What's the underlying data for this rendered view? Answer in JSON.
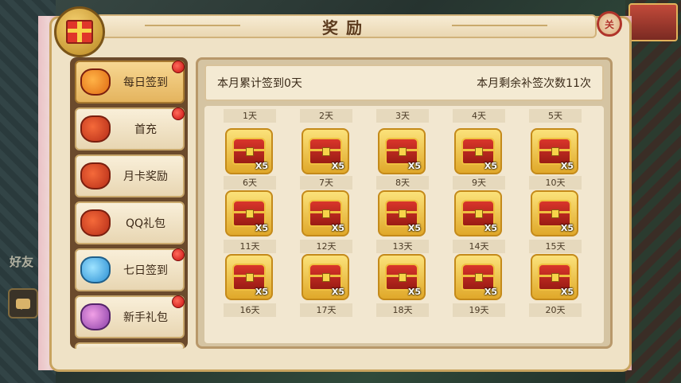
{
  "title": "奖励",
  "close_label": "关",
  "side_label_extra": "好友",
  "sidebar": {
    "items": [
      {
        "label": "每日签到",
        "icon": "coin-bag-icon",
        "active": true,
        "badge": true
      },
      {
        "label": "首充",
        "icon": "gift-bag-icon",
        "active": false,
        "badge": true
      },
      {
        "label": "月卡奖励",
        "icon": "gift-bag-icon",
        "active": false,
        "badge": false
      },
      {
        "label": "QQ礼包",
        "icon": "gift-bag-icon",
        "active": false,
        "badge": false
      },
      {
        "label": "七日签到",
        "icon": "crystal-bag-icon",
        "active": false,
        "badge": true
      },
      {
        "label": "新手礼包",
        "icon": "purple-bag-icon",
        "active": false,
        "badge": true
      }
    ]
  },
  "info": {
    "signed_text": "本月累计签到0天",
    "remaining_text": "本月剩余补签次数11次"
  },
  "days": [
    {
      "label": "1天",
      "qty": "X5"
    },
    {
      "label": "2天",
      "qty": "X5"
    },
    {
      "label": "3天",
      "qty": "X5"
    },
    {
      "label": "4天",
      "qty": "X5"
    },
    {
      "label": "5天",
      "qty": "X5"
    },
    {
      "label": "6天",
      "qty": "X5"
    },
    {
      "label": "7天",
      "qty": "X5"
    },
    {
      "label": "8天",
      "qty": "X5"
    },
    {
      "label": "9天",
      "qty": "X5"
    },
    {
      "label": "10天",
      "qty": "X5"
    },
    {
      "label": "11天",
      "qty": "X5"
    },
    {
      "label": "12天",
      "qty": "X5"
    },
    {
      "label": "13天",
      "qty": "X5"
    },
    {
      "label": "14天",
      "qty": "X5"
    },
    {
      "label": "15天",
      "qty": "X5"
    },
    {
      "label": "16天",
      "qty": "X5"
    },
    {
      "label": "17天",
      "qty": "X5"
    },
    {
      "label": "18天",
      "qty": "X5"
    },
    {
      "label": "19天",
      "qty": "X5"
    },
    {
      "label": "20天",
      "qty": "X5"
    }
  ]
}
